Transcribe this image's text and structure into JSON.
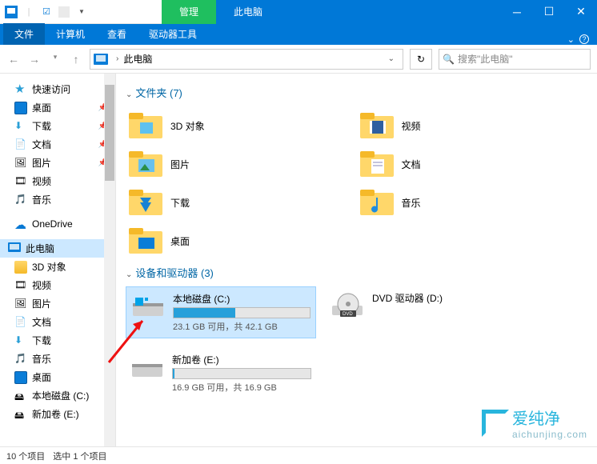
{
  "titlebar": {
    "mgmt_tab": "管理",
    "title": "此电脑"
  },
  "ribbon": {
    "file": "文件",
    "computer": "计算机",
    "view": "查看",
    "drive_tools": "驱动器工具"
  },
  "nav": {
    "breadcrumb": "此电脑",
    "search_placeholder": "搜索\"此电脑\""
  },
  "sidebar": {
    "quick_access": "快速访问",
    "items_qa": [
      {
        "label": "桌面",
        "pin": true
      },
      {
        "label": "下载",
        "pin": true
      },
      {
        "label": "文档",
        "pin": true
      },
      {
        "label": "图片",
        "pin": true
      },
      {
        "label": "视频",
        "pin": false
      },
      {
        "label": "音乐",
        "pin": false
      }
    ],
    "onedrive": "OneDrive",
    "thispc": "此电脑",
    "items_pc": [
      {
        "label": "3D 对象"
      },
      {
        "label": "视频"
      },
      {
        "label": "图片"
      },
      {
        "label": "文档"
      },
      {
        "label": "下载"
      },
      {
        "label": "音乐"
      },
      {
        "label": "桌面"
      },
      {
        "label": "本地磁盘 (C:)"
      },
      {
        "label": "新加卷 (E:)"
      }
    ]
  },
  "main": {
    "folders_header": "文件夹 (7)",
    "folders": [
      {
        "label": "3D 对象"
      },
      {
        "label": "视频"
      },
      {
        "label": "图片"
      },
      {
        "label": "文档"
      },
      {
        "label": "下载"
      },
      {
        "label": "音乐"
      },
      {
        "label": "桌面"
      }
    ],
    "drives_header": "设备和驱动器 (3)",
    "drives": [
      {
        "name": "本地磁盘 (C:)",
        "status": "23.1 GB 可用，共 42.1 GB",
        "fill_pct": 45,
        "selected": true,
        "has_bar": true,
        "bar_color": "blue"
      },
      {
        "name": "DVD 驱动器 (D:)",
        "status": "",
        "has_bar": false
      },
      {
        "name": "新加卷 (E:)",
        "status": "16.9 GB 可用，共 16.9 GB",
        "fill_pct": 1,
        "has_bar": true,
        "bar_color": "blue"
      }
    ]
  },
  "statusbar": {
    "items": "10 个项目",
    "selected": "选中 1 个项目"
  },
  "watermark": {
    "brand": "爱纯净",
    "url": "aichunjing.com"
  }
}
